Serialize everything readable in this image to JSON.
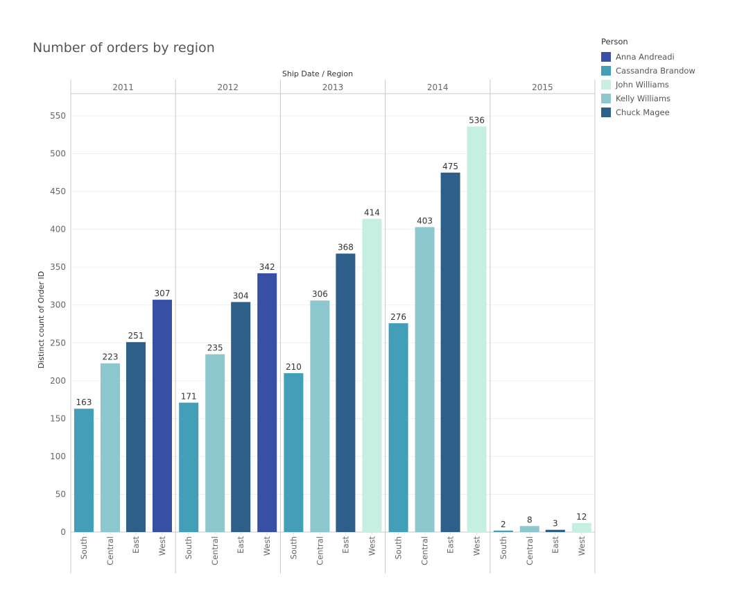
{
  "title": "Number of orders by region",
  "legend": {
    "title": "Person",
    "items": [
      {
        "name": "Anna Andreadi",
        "color": "#3750a5"
      },
      {
        "name": "Cassandra Brandow",
        "color": "#429fb7"
      },
      {
        "name": "John Williams",
        "color": "#c6efe2"
      },
      {
        "name": "Kelly Williams",
        "color": "#8cc8cd"
      },
      {
        "name": "Chuck Magee",
        "color": "#2d5f89"
      }
    ]
  },
  "chart_data": {
    "type": "bar",
    "title": "Number of orders by region",
    "column_header": "Ship Date  /  Region",
    "ylabel": "Distinct count of Order ID",
    "ylim": [
      0,
      600
    ],
    "yticks": [
      0,
      50,
      100,
      150,
      200,
      250,
      300,
      350,
      400,
      450,
      500,
      550
    ],
    "grid": true,
    "legend_position": "top-right",
    "groups": [
      "2011",
      "2012",
      "2013",
      "2014",
      "2015"
    ],
    "categories": [
      "South",
      "Central",
      "East",
      "West"
    ],
    "data": [
      {
        "year": "2011",
        "bars": [
          {
            "region": "South",
            "value": 163,
            "person": "Cassandra Brandow"
          },
          {
            "region": "Central",
            "value": 223,
            "person": "Kelly Williams"
          },
          {
            "region": "East",
            "value": 251,
            "person": "Chuck Magee"
          },
          {
            "region": "West",
            "value": 307,
            "person": "Anna Andreadi"
          }
        ]
      },
      {
        "year": "2012",
        "bars": [
          {
            "region": "South",
            "value": 171,
            "person": "Cassandra Brandow"
          },
          {
            "region": "Central",
            "value": 235,
            "person": "Kelly Williams"
          },
          {
            "region": "East",
            "value": 304,
            "person": "Chuck Magee"
          },
          {
            "region": "West",
            "value": 342,
            "person": "Anna Andreadi"
          }
        ]
      },
      {
        "year": "2013",
        "bars": [
          {
            "region": "South",
            "value": 210,
            "person": "Cassandra Brandow"
          },
          {
            "region": "Central",
            "value": 306,
            "person": "Kelly Williams"
          },
          {
            "region": "East",
            "value": 368,
            "person": "Chuck Magee"
          },
          {
            "region": "West",
            "value": 414,
            "person": "John Williams"
          }
        ]
      },
      {
        "year": "2014",
        "bars": [
          {
            "region": "South",
            "value": 276,
            "person": "Cassandra Brandow"
          },
          {
            "region": "Central",
            "value": 403,
            "person": "Kelly Williams"
          },
          {
            "region": "East",
            "value": 475,
            "person": "Chuck Magee"
          },
          {
            "region": "West",
            "value": 536,
            "person": "John Williams"
          }
        ]
      },
      {
        "year": "2015",
        "bars": [
          {
            "region": "South",
            "value": 2,
            "person": "Cassandra Brandow"
          },
          {
            "region": "Central",
            "value": 8,
            "person": "Kelly Williams"
          },
          {
            "region": "East",
            "value": 3,
            "person": "Chuck Magee"
          },
          {
            "region": "West",
            "value": 12,
            "person": "John Williams"
          }
        ]
      }
    ]
  }
}
